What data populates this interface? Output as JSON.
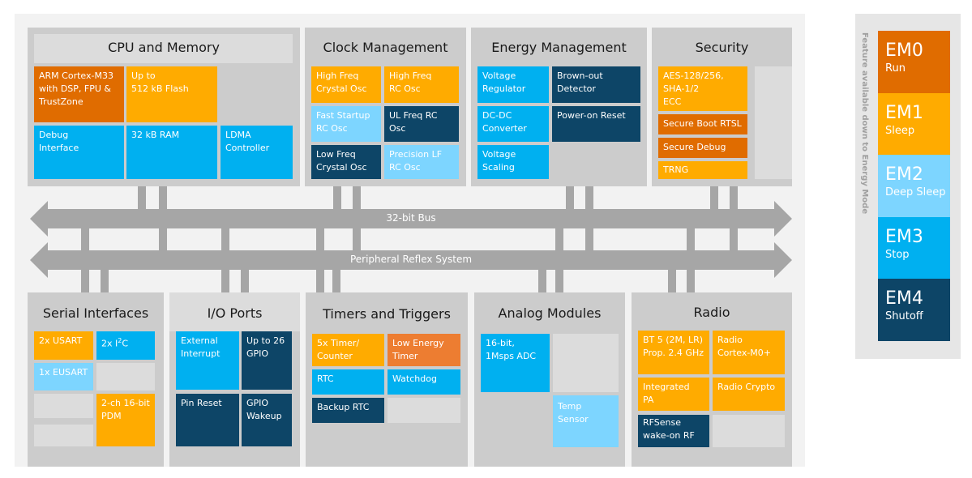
{
  "colors": {
    "em0": "#e06c00",
    "em1": "#ffab00",
    "em2": "#7dd5ff",
    "em3": "#00b0f0",
    "em4": "#0d4567",
    "low_energy_timer": "#ed7d31",
    "bus": "#a6a6a6"
  },
  "cpu": {
    "title": "CPU and Memory",
    "arm": "ARM Cortex-M33\nwith DSP, FPU &\nTrustZone",
    "flash": "Up to\n512 kB Flash",
    "debug": "Debug\nInterface",
    "ram": "32 kB RAM",
    "ldma": "LDMA\nController"
  },
  "clock": {
    "title": "Clock Management",
    "hfxo": "High Freq\nCrystal Osc",
    "hfrco": "High Freq\nRC Osc",
    "fsrco": "Fast Startup\nRC Osc",
    "ulfrco": "UL Freq  RC\nOsc",
    "lfxo": "Low Freq\nCrystal Osc",
    "lfrco": "Precision LF\nRC Osc"
  },
  "energy": {
    "title": "Energy Management",
    "vreg": "Voltage\nRegulator",
    "bod": "Brown-out\nDetector",
    "dcdc": "DC-DC\nConverter",
    "por": "Power-on Reset",
    "vscale": "Voltage\nScaling"
  },
  "security": {
    "title": "Security",
    "aes": "AES-128/256,\nSHA-1/2\nECC",
    "boot": "Secure Boot RTSL",
    "debug": "Secure Debug",
    "trng": "TRNG"
  },
  "bus": {
    "main": "32-bit Bus",
    "prs": "Peripheral Reflex System"
  },
  "serial": {
    "title": "Serial Interfaces",
    "usart": "2x USART",
    "i2c_pre": "2x I",
    "i2c_sup": "2",
    "i2c_post": "C",
    "eusart": "1x EUSART",
    "pdm": "2-ch 16-bit\nPDM"
  },
  "io": {
    "title": "I/O Ports",
    "extint": "External\nInterrupt",
    "gpio": "Up to 26\nGPIO",
    "pinreset": "Pin Reset",
    "wakeup": "GPIO\nWakeup"
  },
  "timers": {
    "title": "Timers and Triggers",
    "timer": "5x Timer/\nCounter",
    "letimer": "Low Energy\nTimer",
    "rtc": "RTC",
    "wdog": "Watchdog",
    "brtc": "Backup RTC"
  },
  "analog": {
    "title": "Analog Modules",
    "adc": "16-bit,\n1Msps ADC",
    "temp": "Temp\nSensor"
  },
  "radio": {
    "title": "Radio",
    "bt": "BT 5 (2M, LR)\nProp. 2.4 GHz",
    "m0": "Radio\nCortex-M0+",
    "pa": "Integrated\nPA",
    "crypto": "Radio Crypto",
    "rfsense": "RFSense\nwake-on RF"
  },
  "legend": {
    "caption": "Feature available  down to Energy Mode",
    "modes": [
      {
        "name": "EM0",
        "desc": "Run"
      },
      {
        "name": "EM1",
        "desc": "Sleep"
      },
      {
        "name": "EM2",
        "desc": "Deep Sleep"
      },
      {
        "name": "EM3",
        "desc": "Stop"
      },
      {
        "name": "EM4",
        "desc": "Shutoff"
      }
    ]
  }
}
